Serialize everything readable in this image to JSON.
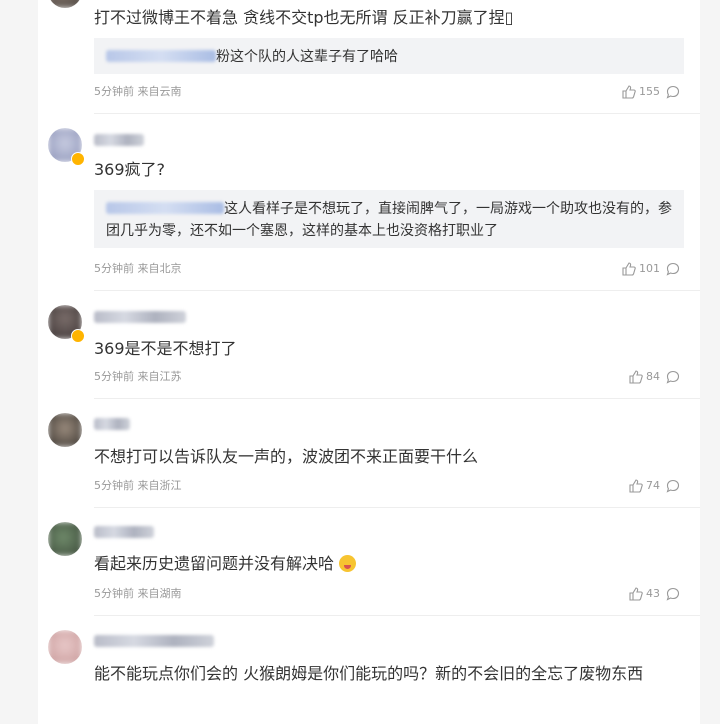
{
  "comments": [
    {
      "text": "打不过微博王不着急 贪线不交tp也无所谓 反正补刀赢了捏▯",
      "reply": {
        "text": "粉这个队的人这辈子有了哈哈"
      },
      "time": "5分钟前",
      "location": "来自云南",
      "likes": "155"
    },
    {
      "text": "369疯了?",
      "reply": {
        "text": "这人看样子是不想玩了，直接闹脾气了，一局游戏一个助攻也没有的，参团几乎为零，还不如一个塞恩，这样的基本上也没资格打职业了"
      },
      "time": "5分钟前",
      "location": "来自北京",
      "likes": "101"
    },
    {
      "text": "369是不是不想打了",
      "time": "5分钟前",
      "location": "来自江苏",
      "likes": "84"
    },
    {
      "text": "不想打可以告诉队友一声的，波波团不来正面要干什么",
      "time": "5分钟前",
      "location": "来自浙江",
      "likes": "74"
    },
    {
      "text": "看起来历史遗留问题并没有解决哈",
      "emoji": "thinking-emoji",
      "time": "5分钟前",
      "location": "来自湖南",
      "likes": "43"
    },
    {
      "text": "能不能玩点你们会的 火猴朗姆是你们能玩的吗？新的不会旧的全忘了废物东西"
    }
  ],
  "icons": {
    "like": "thumbs-up-icon",
    "comment": "comment-bubble-icon"
  }
}
